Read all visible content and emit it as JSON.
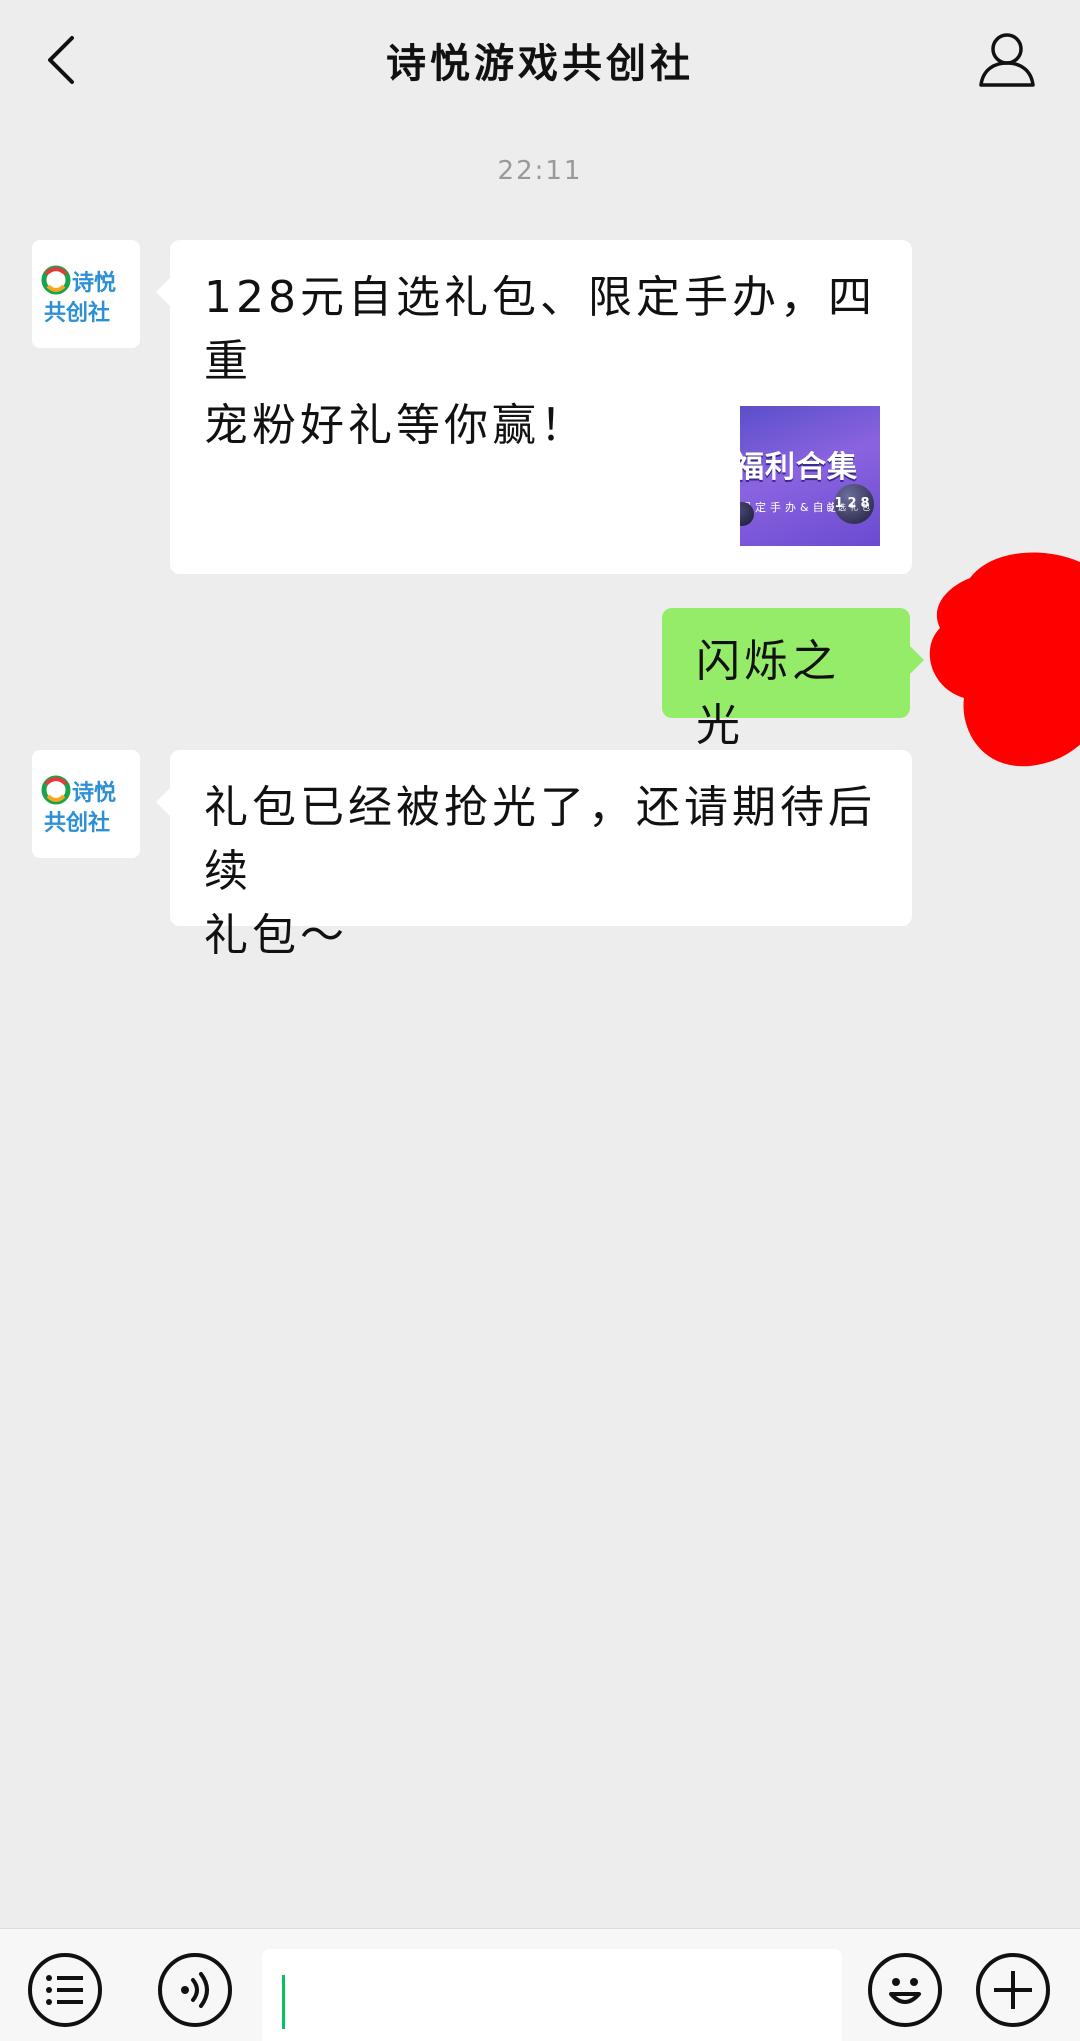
{
  "header": {
    "title": "诗悦游戏共创社",
    "back_icon": "chevron-left-icon",
    "profile_icon": "person-icon"
  },
  "timestamp": "22:11",
  "messages": [
    {
      "side": "left",
      "sender": "诗悦共创社",
      "lines": [
        "128元自选礼包、限定手办，四重",
        "宠粉好礼等你赢！"
      ],
      "thumbnail": {
        "title": "福利合集",
        "subtitle": "限定手办&自选礼包",
        "badge": "128",
        "tag": "自选礼包"
      }
    },
    {
      "side": "right",
      "text": "闪烁之光"
    },
    {
      "side": "left",
      "sender": "诗悦共创社",
      "lines": [
        "礼包已经被抢光了，还请期待后续",
        "礼包～"
      ]
    }
  ],
  "avatar": {
    "line1": "诗悦",
    "line2": "共创社"
  },
  "bottom_bar": {
    "menu_icon": "list-menu-icon",
    "voice_icon": "voice-icon",
    "emoji_icon": "emoji-icon",
    "plus_icon": "plus-icon",
    "input_value": ""
  },
  "colors": {
    "background": "#ededed",
    "sent_bubble": "#95ec69",
    "received_bubble": "#ffffff",
    "caret": "#07c160",
    "redaction": "#ff0000"
  }
}
